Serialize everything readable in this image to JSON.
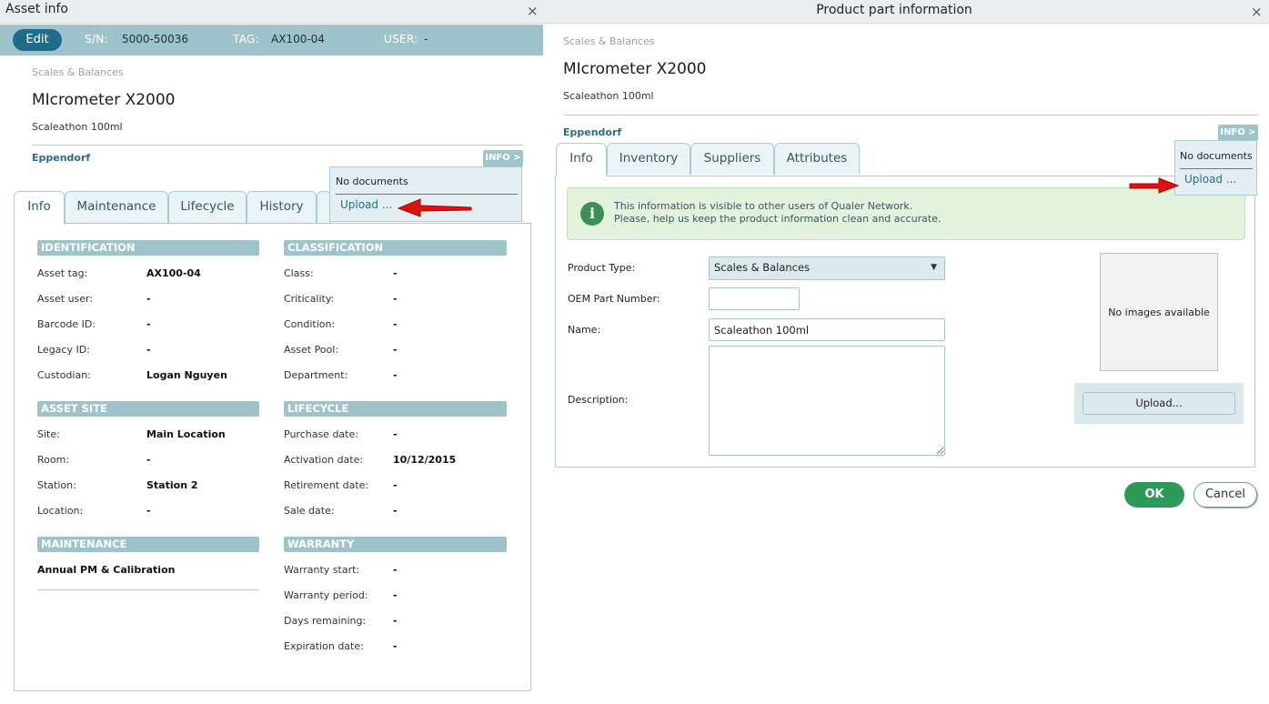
{
  "left": {
    "title": "Asset info",
    "close": "×",
    "edit_label": "Edit",
    "sn_label": "S/N:",
    "sn_value": "5000-50036",
    "tag_label": "TAG:",
    "tag_value": "AX100-04",
    "user_label": "USER:",
    "user_value": "-",
    "category": "Scales & Balances",
    "product_name": "MIcrometer X2000",
    "product_subtitle": "Scaleathon 100ml",
    "brand": "Eppendorf",
    "info_toggle": "INFO >",
    "docs": {
      "none": "No documents",
      "upload": "Upload ..."
    },
    "tabs": [
      "Info",
      "Maintenance",
      "Lifecycle",
      "History"
    ],
    "sections": {
      "identification": {
        "title": "IDENTIFICATION",
        "rows": [
          {
            "label": "Asset tag:",
            "value": "AX100-04"
          },
          {
            "label": "Asset user:",
            "value": "-"
          },
          {
            "label": "Barcode ID:",
            "value": "-"
          },
          {
            "label": "Legacy ID:",
            "value": "-"
          },
          {
            "label": "Custodian:",
            "value": "Logan Nguyen"
          }
        ]
      },
      "classification": {
        "title": "CLASSIFICATION",
        "rows": [
          {
            "label": "Class:",
            "value": "-"
          },
          {
            "label": "Criticality:",
            "value": "-"
          },
          {
            "label": "Condition:",
            "value": "-"
          },
          {
            "label": "Asset Pool:",
            "value": "-"
          },
          {
            "label": "Department:",
            "value": "-"
          }
        ]
      },
      "asset_site": {
        "title": "ASSET SITE",
        "rows": [
          {
            "label": "Site:",
            "value": "Main Location"
          },
          {
            "label": "Room:",
            "value": "-"
          },
          {
            "label": "Station:",
            "value": "Station 2"
          },
          {
            "label": "Location:",
            "value": "-"
          }
        ]
      },
      "lifecycle": {
        "title": "LIFECYCLE",
        "rows": [
          {
            "label": "Purchase date:",
            "value": "-"
          },
          {
            "label": "Activation date:",
            "value": "10/12/2015"
          },
          {
            "label": "Retirement date:",
            "value": "-"
          },
          {
            "label": "Sale date:",
            "value": "-"
          }
        ]
      },
      "maintenance": {
        "title": "MAINTENANCE",
        "item": "Annual PM & Calibration"
      },
      "warranty": {
        "title": "WARRANTY",
        "rows": [
          {
            "label": "Warranty start:",
            "value": "-"
          },
          {
            "label": "Warranty period:",
            "value": "-"
          },
          {
            "label": "Days remaining:",
            "value": "-"
          },
          {
            "label": "Expiration date:",
            "value": "-"
          }
        ]
      }
    }
  },
  "right": {
    "title": "Product part information",
    "close": "×",
    "category": "Scales & Balances",
    "product_name": "MIcrometer X2000",
    "product_subtitle": "Scaleathon 100ml",
    "brand": "Eppendorf",
    "info_toggle": "INFO >",
    "docs": {
      "none": "No documents",
      "upload": "Upload ..."
    },
    "tabs": [
      "Info",
      "Inventory",
      "Suppliers",
      "Attributes"
    ],
    "notice_line1": "This information is visible to other users of Qualer Network.",
    "notice_line2": "Please, help us keep the product information clean and accurate.",
    "form": {
      "product_type_label": "Product Type:",
      "product_type_value": "Scales & Balances",
      "oem_label": "OEM Part Number:",
      "oem_value": "",
      "name_label": "Name:",
      "name_value": "Scaleathon 100ml",
      "description_label": "Description:",
      "description_value": ""
    },
    "no_images": "No images available",
    "upload_image": "Upload...",
    "ok": "OK",
    "cancel": "Cancel"
  },
  "colors": {
    "header_teal": "#9fc3cb",
    "edit_blue": "#1e6c8b",
    "brand_text": "#2c6b87",
    "ok_green": "#2e9a5a",
    "notice_bg": "#e3f2dc",
    "arrow_red": "#e0120e"
  }
}
